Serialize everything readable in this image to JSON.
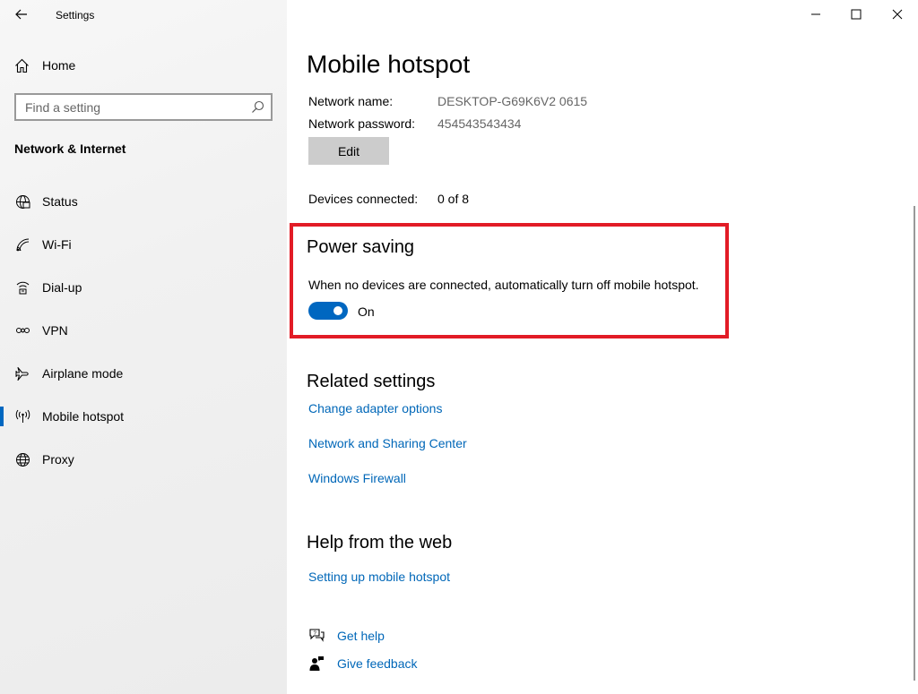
{
  "window": {
    "title": "Settings"
  },
  "sidebar": {
    "home_label": "Home",
    "search_placeholder": "Find a setting",
    "section_title": "Network & Internet",
    "items": [
      {
        "label": "Status",
        "icon": "globe-status-icon"
      },
      {
        "label": "Wi-Fi",
        "icon": "wifi-icon"
      },
      {
        "label": "Dial-up",
        "icon": "dialup-icon"
      },
      {
        "label": "VPN",
        "icon": "vpn-icon"
      },
      {
        "label": "Airplane mode",
        "icon": "airplane-icon"
      },
      {
        "label": "Mobile hotspot",
        "icon": "hotspot-icon",
        "active": true
      },
      {
        "label": "Proxy",
        "icon": "globe-icon"
      }
    ]
  },
  "main": {
    "title": "Mobile hotspot",
    "network_name_label": "Network name:",
    "network_name_value": "DESKTOP-G69K6V2 0615",
    "network_password_label": "Network password:",
    "network_password_value": "454543543434",
    "edit_label": "Edit",
    "devices_label": "Devices connected:",
    "devices_value": "0 of 8",
    "power_saving": {
      "title": "Power saving",
      "description": "When no devices are connected, automatically turn off mobile hotspot.",
      "toggle_state": "On"
    },
    "related": {
      "title": "Related settings",
      "links": [
        "Change adapter options",
        "Network and Sharing Center",
        "Windows Firewall"
      ]
    },
    "help_web": {
      "title": "Help from the web",
      "links": [
        "Setting up mobile hotspot"
      ]
    },
    "get_help": "Get help",
    "give_feedback": "Give feedback"
  },
  "colors": {
    "accent": "#0067c0",
    "link": "#0067b8",
    "highlight_border": "#e21c26"
  }
}
